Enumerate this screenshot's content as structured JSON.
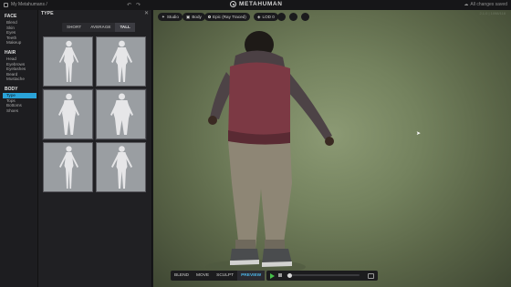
{
  "topbar": {
    "breadcrumb": "My Metahumans /",
    "undo_icon": "undo-icon",
    "redo_icon": "redo-icon",
    "brand": "METAHUMAN",
    "saved_status": "All changes saved"
  },
  "leftnav": {
    "groups": [
      {
        "title": "FACE",
        "items": [
          "Blend",
          "Skin",
          "Eyes",
          "Teeth",
          "Makeup"
        ]
      },
      {
        "title": "HAIR",
        "items": [
          "Head",
          "Eyebrows",
          "Eyelashes",
          "Beard",
          "Mustache"
        ]
      },
      {
        "title": "BODY",
        "items": [
          "Type",
          "Tops",
          "Bottoms",
          "Shoes"
        ]
      }
    ],
    "active_item": "Type"
  },
  "panel": {
    "title": "TYPE",
    "close_icon": "close-icon",
    "segments": [
      "SHORT",
      "AVERAGE",
      "TALL"
    ],
    "active_segment": "TALL",
    "thumbnails": [
      "body-1",
      "body-2",
      "body-3",
      "body-4",
      "body-5",
      "body-6"
    ]
  },
  "viewport": {
    "toolbar": {
      "environment": "Studio",
      "camera": "Body",
      "quality": "Epic (Ray Traced)",
      "lod": "LOD 0"
    },
    "version": "2.1.0 | 1098/118"
  },
  "bottom": {
    "modes": [
      "BLEND",
      "MOVE",
      "SCULPT",
      "PREVIEW"
    ],
    "active_mode": "PREVIEW"
  }
}
